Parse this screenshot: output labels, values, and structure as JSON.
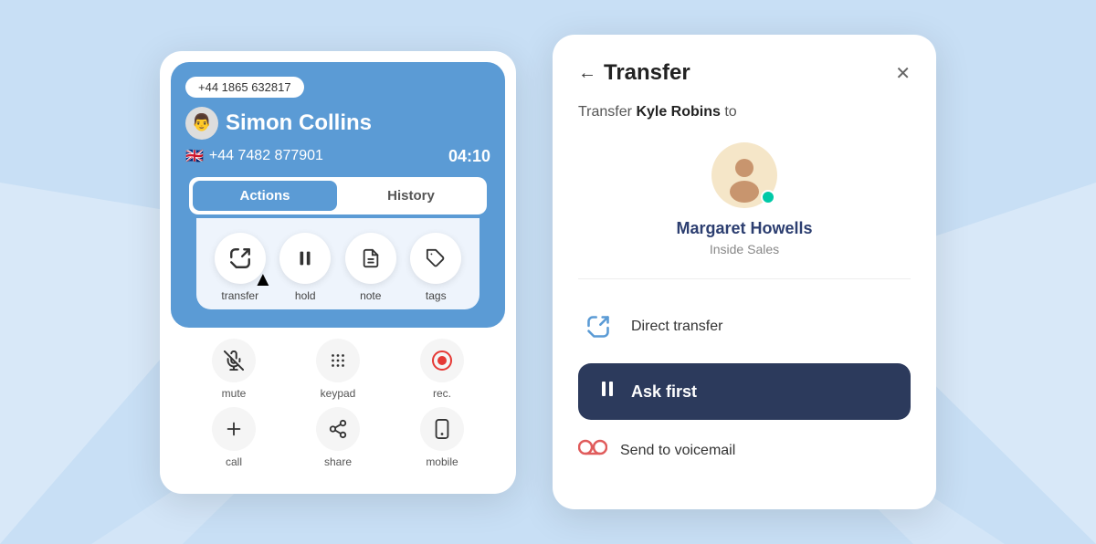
{
  "background": "#c8dff5",
  "left_panel": {
    "phone_number": "+44 1865 632817",
    "caller_name": "Simon Collins",
    "caller_phone": "+44 7482 877901",
    "call_timer": "04:10",
    "tabs": [
      {
        "id": "actions",
        "label": "Actions",
        "active": true
      },
      {
        "id": "history",
        "label": "History",
        "active": false
      }
    ],
    "action_buttons": [
      {
        "id": "transfer",
        "label": "transfer",
        "icon": "transfer"
      },
      {
        "id": "hold",
        "label": "hold",
        "icon": "pause"
      },
      {
        "id": "note",
        "label": "note",
        "icon": "note"
      },
      {
        "id": "tags",
        "label": "tags",
        "icon": "tag"
      }
    ],
    "bottom_controls_row1": [
      {
        "id": "mute",
        "label": "mute",
        "icon": "mute"
      },
      {
        "id": "keypad",
        "label": "keypad",
        "icon": "keypad"
      },
      {
        "id": "rec",
        "label": "rec.",
        "icon": "rec"
      }
    ],
    "bottom_controls_row2": [
      {
        "id": "call",
        "label": "call",
        "icon": "call"
      },
      {
        "id": "share",
        "label": "share",
        "icon": "share"
      },
      {
        "id": "mobile",
        "label": "mobile",
        "icon": "mobile"
      }
    ]
  },
  "right_panel": {
    "title": "Transfer",
    "subtitle_prefix": "Transfer",
    "caller_bold": "Kyle Robins",
    "subtitle_suffix": "to",
    "agent_name": "Margaret Howells",
    "agent_dept": "Inside Sales",
    "options": [
      {
        "id": "direct_transfer",
        "label": "Direct transfer",
        "icon": "transfer"
      },
      {
        "id": "ask_first",
        "label": "Ask first",
        "icon": "pause",
        "highlighted": true
      },
      {
        "id": "voicemail",
        "label": "Send to voicemail",
        "icon": "voicemail"
      }
    ]
  }
}
